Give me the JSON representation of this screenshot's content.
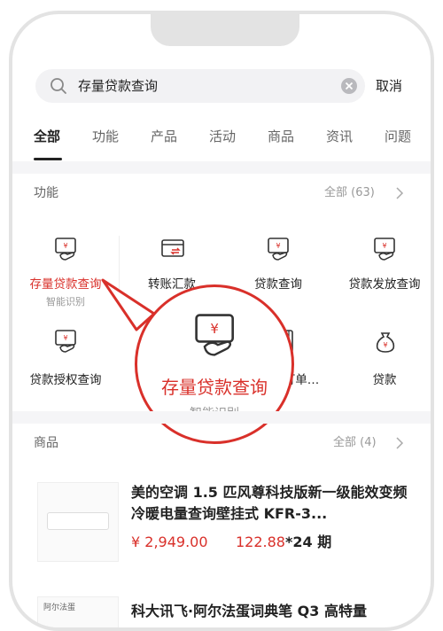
{
  "search": {
    "query": "存量贷款查询",
    "cancel": "取消"
  },
  "tabs": [
    "全部",
    "功能",
    "产品",
    "活动",
    "商品",
    "资讯",
    "问题"
  ],
  "functions": {
    "title": "功能",
    "more": "全部 (63)",
    "items": [
      {
        "label": "存量贷款查询",
        "sub": "智能识别",
        "icon": "loan-hand-icon"
      },
      {
        "label": "转账汇款",
        "icon": "transfer-card-icon"
      },
      {
        "label": "贷款查询",
        "icon": "loan-hand-icon"
      },
      {
        "label": "贷款发放查询",
        "icon": "loan-hand-icon"
      },
      {
        "label": "贷款授权查询",
        "icon": "loan-hand-icon"
      },
      {
        "label": "订单…",
        "icon": "order-icon"
      },
      {
        "label": "贷款",
        "icon": "money-bag-icon"
      }
    ],
    "bubble": {
      "label": "存量贷款查询",
      "sub": "智能识别"
    }
  },
  "products": {
    "title": "商品",
    "more": "全部 (4)",
    "items": [
      {
        "name": "美的空调 1.5 匹风尊科技版新一级能效变频冷暖电量查询壁挂式 KFR-3...",
        "price": "¥ 2,949.00",
        "installment_amount": "122.88",
        "installment_terms": "*24 期"
      },
      {
        "name": "科大讯飞·阿尔法蛋词典笔 Q3 高特量",
        "tag": "阿尔法蛋"
      }
    ]
  },
  "colors": {
    "accent": "#d9302a"
  }
}
